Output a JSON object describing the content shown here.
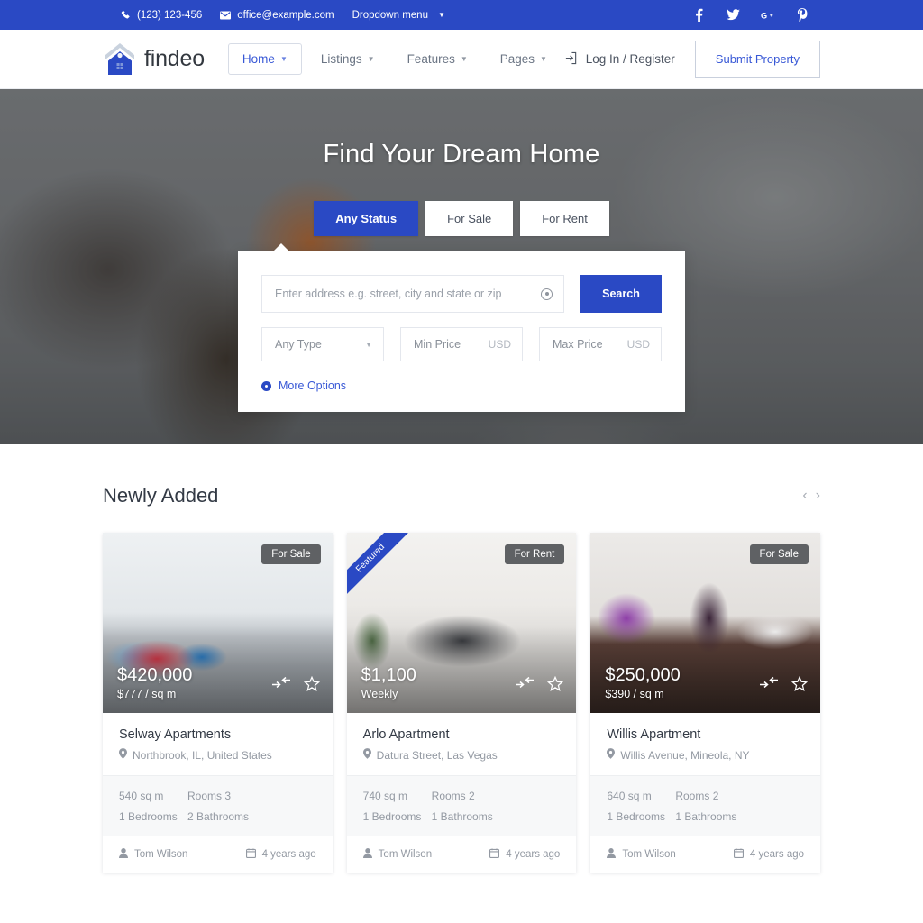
{
  "topbar": {
    "phone": "(123) 123-456",
    "email": "office@example.com",
    "dropdown": "Dropdown menu",
    "social": [
      {
        "name": "facebook-icon",
        "glyph": "f"
      },
      {
        "name": "twitter-icon",
        "glyph": "t"
      },
      {
        "name": "google-plus-icon",
        "glyph": "G+"
      },
      {
        "name": "pinterest-icon",
        "glyph": "P"
      }
    ],
    "bg_color": "#2a49c4"
  },
  "header": {
    "brand": "findeo",
    "nav": [
      {
        "label": "Home",
        "active": true
      },
      {
        "label": "Listings",
        "active": false
      },
      {
        "label": "Features",
        "active": false
      },
      {
        "label": "Pages",
        "active": false
      }
    ],
    "login_label": "Log In / Register",
    "submit_label": "Submit Property"
  },
  "hero": {
    "title": "Find Your Dream Home",
    "status_tabs": [
      {
        "label": "Any Status",
        "active": true
      },
      {
        "label": "For Sale",
        "active": false
      },
      {
        "label": "For Rent",
        "active": false
      }
    ],
    "search": {
      "address_placeholder": "Enter address e.g. street, city and state or zip",
      "address_value": "",
      "search_button": "Search",
      "type_value": "Any Type",
      "min_price_placeholder": "Min Price",
      "min_price_unit": "USD",
      "max_price_placeholder": "Max Price",
      "max_price_unit": "USD",
      "more_options": "More Options"
    },
    "accent_color": "#2a49c4"
  },
  "newly_added": {
    "title": "Newly Added",
    "prev_arrow": "‹",
    "next_arrow": "›",
    "cards": [
      {
        "badge": "For Sale",
        "featured": null,
        "price": "$420,000",
        "price_sub": "$777 / sq m",
        "title": "Selway Apartments",
        "address": "Northbrook, IL, United States",
        "area": "540 sq m",
        "rooms": "Rooms 3",
        "bedrooms": "1 Bedrooms",
        "bathrooms": "2 Bathrooms",
        "author": "Tom Wilson",
        "date": "4 years ago"
      },
      {
        "badge": "For Rent",
        "featured": "Featured",
        "price": "$1,100",
        "price_sub": "Weekly",
        "title": "Arlo Apartment",
        "address": "Datura Street, Las Vegas",
        "area": "740 sq m",
        "rooms": "Rooms 2",
        "bedrooms": "1 Bedrooms",
        "bathrooms": "1 Bathrooms",
        "author": "Tom Wilson",
        "date": "4 years ago"
      },
      {
        "badge": "For Sale",
        "featured": null,
        "price": "$250,000",
        "price_sub": "$390 / sq m",
        "title": "Willis Apartment",
        "address": "Willis Avenue, Mineola, NY",
        "area": "640 sq m",
        "rooms": "Rooms 2",
        "bedrooms": "1 Bedrooms",
        "bathrooms": "1 Bathrooms",
        "author": "Tom Wilson",
        "date": "4 years ago"
      }
    ]
  }
}
